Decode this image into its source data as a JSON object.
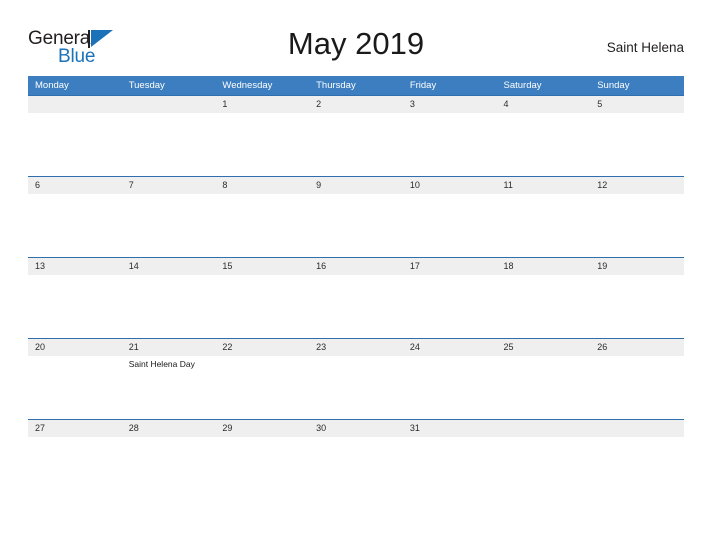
{
  "brand": {
    "name_part1": "General",
    "name_part2": "Blue",
    "accent_color": "#1c72b8"
  },
  "header": {
    "title": "May 2019",
    "location": "Saint Helena"
  },
  "theme": {
    "header_band": "#3c7ebf",
    "date_band": "#efefef",
    "row_rule": "#2f6fad"
  },
  "calendar": {
    "weekdays": [
      "Monday",
      "Tuesday",
      "Wednesday",
      "Thursday",
      "Friday",
      "Saturday",
      "Sunday"
    ],
    "weeks": [
      {
        "days": [
          {
            "num": "",
            "event": ""
          },
          {
            "num": "",
            "event": ""
          },
          {
            "num": "1",
            "event": ""
          },
          {
            "num": "2",
            "event": ""
          },
          {
            "num": "3",
            "event": ""
          },
          {
            "num": "4",
            "event": ""
          },
          {
            "num": "5",
            "event": ""
          }
        ]
      },
      {
        "days": [
          {
            "num": "6",
            "event": ""
          },
          {
            "num": "7",
            "event": ""
          },
          {
            "num": "8",
            "event": ""
          },
          {
            "num": "9",
            "event": ""
          },
          {
            "num": "10",
            "event": ""
          },
          {
            "num": "11",
            "event": ""
          },
          {
            "num": "12",
            "event": ""
          }
        ]
      },
      {
        "days": [
          {
            "num": "13",
            "event": ""
          },
          {
            "num": "14",
            "event": ""
          },
          {
            "num": "15",
            "event": ""
          },
          {
            "num": "16",
            "event": ""
          },
          {
            "num": "17",
            "event": ""
          },
          {
            "num": "18",
            "event": ""
          },
          {
            "num": "19",
            "event": ""
          }
        ]
      },
      {
        "days": [
          {
            "num": "20",
            "event": ""
          },
          {
            "num": "21",
            "event": "Saint Helena Day"
          },
          {
            "num": "22",
            "event": ""
          },
          {
            "num": "23",
            "event": ""
          },
          {
            "num": "24",
            "event": ""
          },
          {
            "num": "25",
            "event": ""
          },
          {
            "num": "26",
            "event": ""
          }
        ]
      },
      {
        "days": [
          {
            "num": "27",
            "event": ""
          },
          {
            "num": "28",
            "event": ""
          },
          {
            "num": "29",
            "event": ""
          },
          {
            "num": "30",
            "event": ""
          },
          {
            "num": "31",
            "event": ""
          },
          {
            "num": "",
            "event": ""
          },
          {
            "num": "",
            "event": ""
          }
        ]
      }
    ]
  }
}
